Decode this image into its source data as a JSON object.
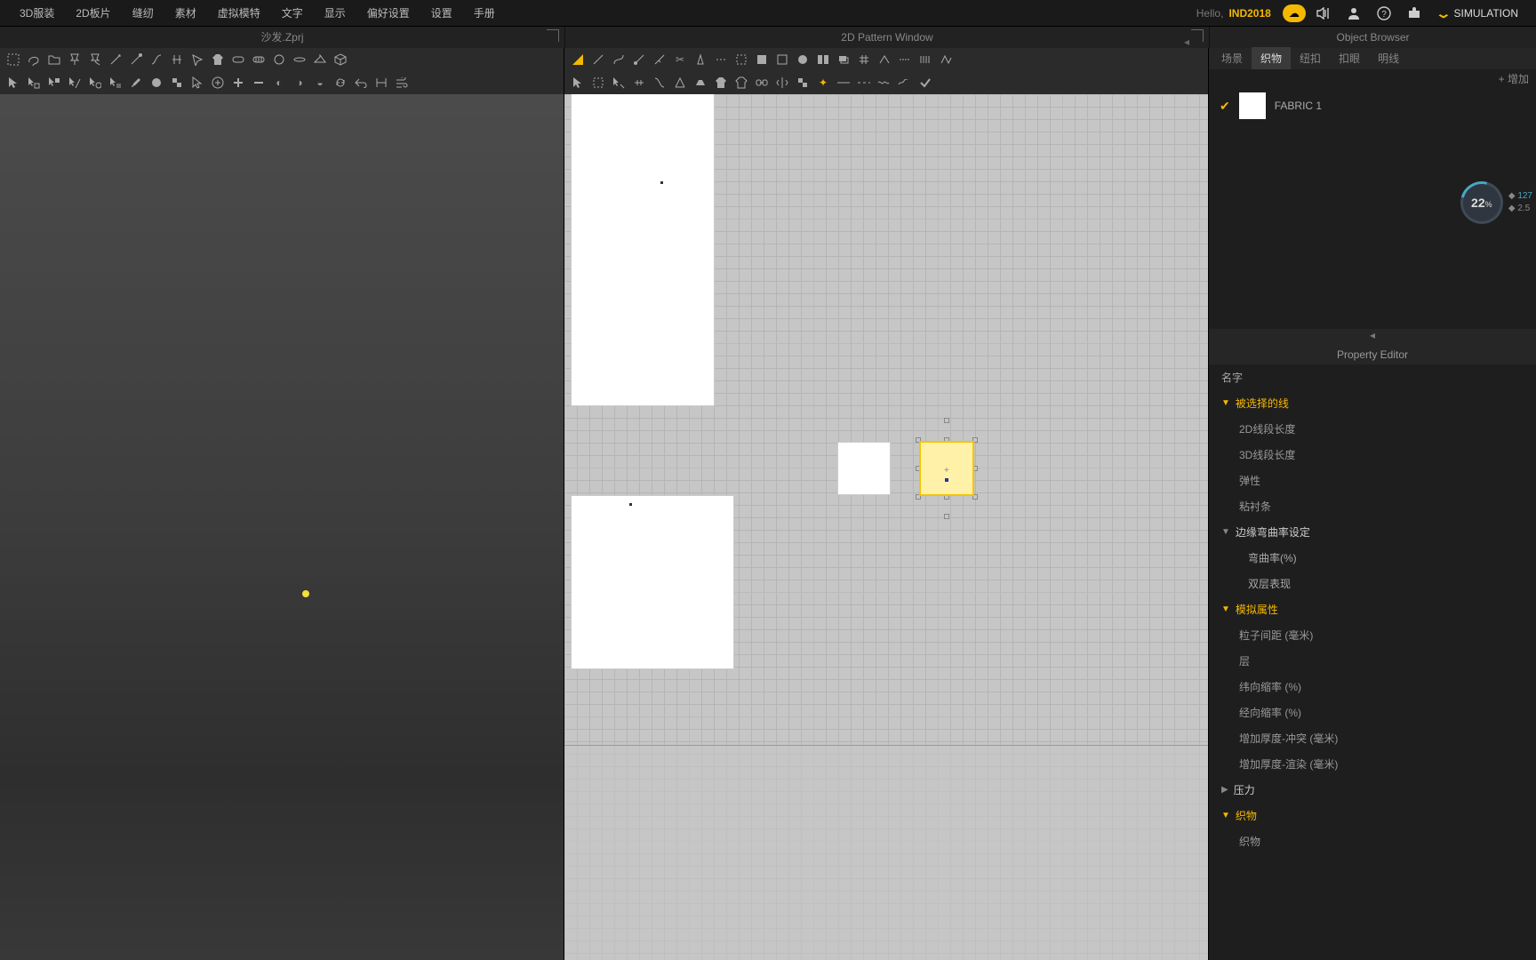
{
  "menu": {
    "items": [
      "3D服装",
      "2D板片",
      "缝纫",
      "素材",
      "虚拟模特",
      "文字",
      "显示",
      "偏好设置",
      "设置",
      "手册"
    ],
    "hello": "Hello,",
    "user": "IND2018",
    "simulation": "SIMULATION"
  },
  "titles": {
    "left": "沙发.Zprj",
    "mid": "2D Pattern Window",
    "right": "Object Browser"
  },
  "tabs": {
    "t0": "场景",
    "t1": "织物",
    "t2": "纽扣",
    "t3": "扣眼",
    "t4": "明线"
  },
  "browser": {
    "add": "+ 增加",
    "fabric": "FABRIC 1",
    "gauge_pct": "22",
    "gauge_pct_suffix": "%",
    "gauge_a": "127",
    "gauge_b": "2.5"
  },
  "props": {
    "title": "Property Editor",
    "name": "名字",
    "selected_line": "被选择的线",
    "len2d": "2D线段长度",
    "len3d": "3D线段长度",
    "elastic": "弹性",
    "interlining": "粘衬条",
    "edge_curve": "边缘弯曲率设定",
    "curve": "弯曲率(%)",
    "double": "双层表现",
    "sim": "模拟属性",
    "particle": "粒子间距 (毫米)",
    "layer": "层",
    "weft": "纬向缩率 (%)",
    "warp": "经向缩率 (%)",
    "thk_collision": "增加厚度-冲突 (毫米)",
    "thk_render": "增加厚度-渲染 (毫米)",
    "pressure": "压力",
    "fabric": "织物",
    "fabric_sub": "织物"
  }
}
